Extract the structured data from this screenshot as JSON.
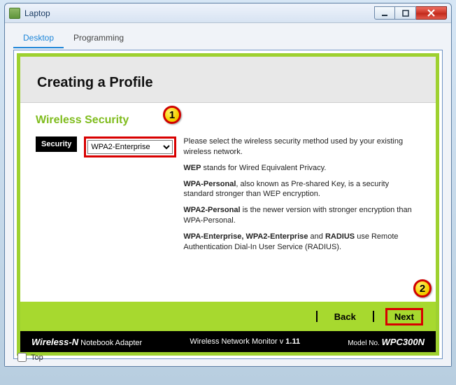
{
  "window": {
    "title": "Laptop",
    "bg_tabs": [
      "",
      "",
      ""
    ],
    "controls": {
      "min": "minimize",
      "max": "maximize",
      "close": "close"
    }
  },
  "tabs": {
    "active": "Desktop",
    "other": "Programming"
  },
  "panel": {
    "heading": "Creating a Profile",
    "section_title": "Wireless Security",
    "security_label": "Security",
    "security_selected": "WPA2-Enterprise",
    "desc_intro": "Please select the wireless security method used by your existing wireless network.",
    "desc_wep_b": "WEP",
    "desc_wep_rest": " stands for Wired Equivalent Privacy.",
    "desc_wpap_b": "WPA-Personal",
    "desc_wpap_rest": ", also known as Pre-shared Key, is a security standard stronger than WEP encryption.",
    "desc_wpa2p_b": "WPA2-Personal",
    "desc_wpa2p_rest": " is the newer version with stronger encryption than WPA-Personal.",
    "desc_ent_b1": "WPA-Enterprise, WPA2-Enterprise",
    "desc_ent_mid": " and ",
    "desc_ent_b2": "RADIUS",
    "desc_ent_rest": " use Remote Authentication Dial-In User Service (RADIUS)."
  },
  "callouts": {
    "one": "1",
    "two": "2"
  },
  "actions": {
    "back": "Back",
    "next": "Next"
  },
  "footer": {
    "brand_bold": "Wireless-N",
    "brand_rest": " Notebook Adapter",
    "monitor_name": "Wireless Network Monitor",
    "monitor_v_prefix": " v ",
    "monitor_version": "1.11",
    "model_label": "Model No. ",
    "model_value": "WPC300N"
  },
  "top_checkbox": {
    "label": "Top",
    "checked": false
  }
}
